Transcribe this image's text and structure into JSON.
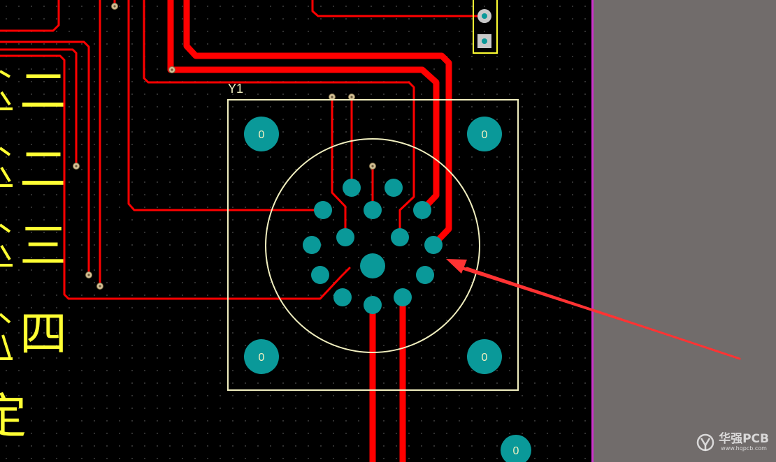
{
  "component": {
    "designator": "Y1"
  },
  "mounting_pad_label": "0",
  "silkscreen_chars": [
    "二",
    "二",
    "三",
    "四",
    "定"
  ],
  "watermark": {
    "brand": "华强PCB",
    "url": "www.hqpcb.com"
  },
  "colors": {
    "background": "#000000",
    "trace": "#ff0000",
    "pad": "#0a9999",
    "silkscreen_outline": "#f2f0c0",
    "silkscreen_text": "#ffff33",
    "via": "#c8b48c",
    "board_edge": "#cc33cc",
    "outside_area": "#716c6b",
    "arrow": "#ff3333",
    "header_outline": "#ffff33"
  }
}
